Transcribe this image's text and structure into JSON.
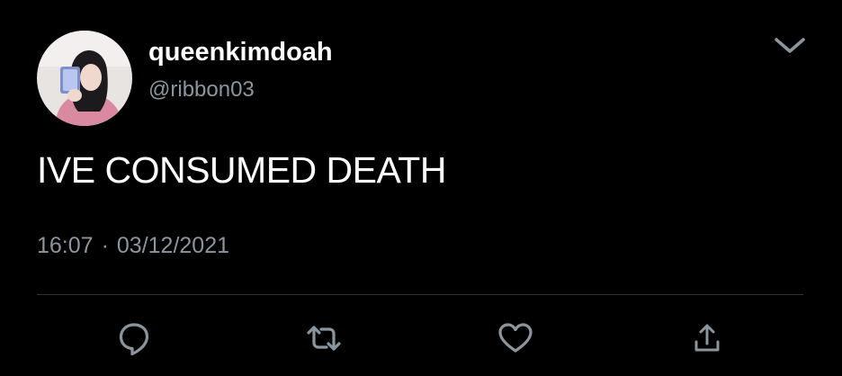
{
  "tweet": {
    "display_name": "queenkimdoah",
    "handle": "@ribbon03",
    "text": "IVE CONSUMED DEATH",
    "time": "16:07",
    "separator": "·",
    "date": "03/12/2021"
  },
  "icons": {
    "menu": "chevron-down-icon",
    "reply": "reply-icon",
    "retweet": "retweet-icon",
    "like": "heart-icon",
    "share": "share-icon"
  },
  "colors": {
    "background": "#000000",
    "primary_text": "#ffffff",
    "secondary_text": "#8b959e",
    "icon": "#8b959e",
    "divider": "#2f3336"
  }
}
